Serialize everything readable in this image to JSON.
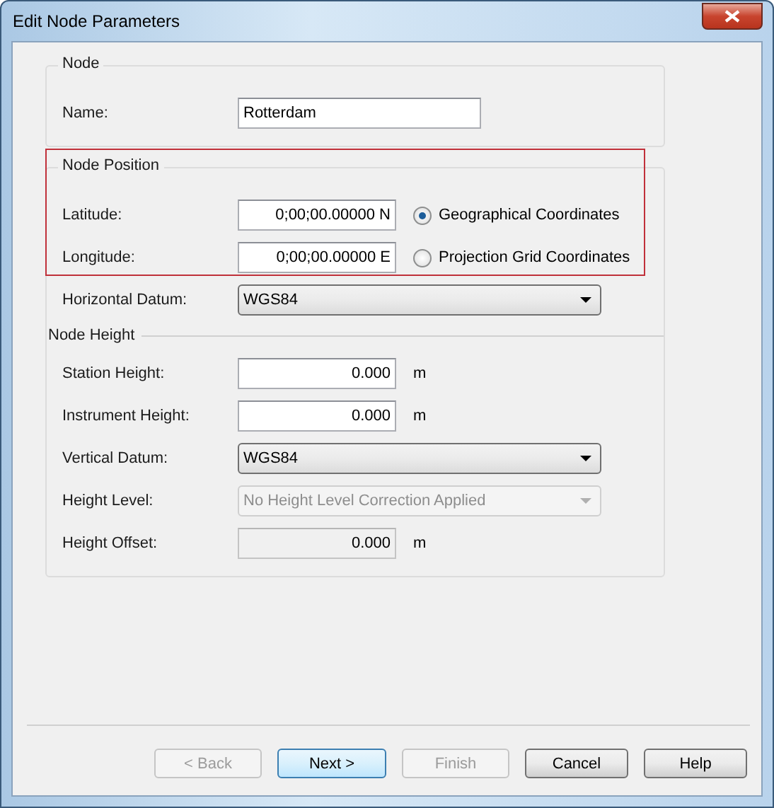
{
  "window": {
    "title": "Edit Node Parameters"
  },
  "node_group": {
    "title": "Node",
    "name_label": "Name:",
    "name_value": "Rotterdam"
  },
  "position_group": {
    "title": "Node Position",
    "highlighted": true,
    "rows": [
      {
        "label": "Latitude:",
        "value": "0;00;00.00000 N",
        "option": {
          "label": "Geographical Coordinates",
          "selected": true
        }
      },
      {
        "label": "Longitude:",
        "value": "0;00;00.00000 E",
        "option": {
          "label": "Projection Grid Coordinates",
          "selected": false
        }
      }
    ],
    "horizontal_datum": {
      "label": "Horizontal Datum:",
      "value": "WGS84"
    }
  },
  "height_group": {
    "title": "Node Height",
    "fields": [
      {
        "kind": "input",
        "label": "Station Height:",
        "value": "0.000",
        "unit": "m",
        "disabled": false
      },
      {
        "kind": "input",
        "label": "Instrument Height:",
        "value": "0.000",
        "unit": "m",
        "disabled": false
      },
      {
        "kind": "dropdown",
        "label": "Vertical Datum:",
        "value": "WGS84",
        "disabled": false
      },
      {
        "kind": "dropdown",
        "label": "Height Level:",
        "value": "No Height Level Correction Applied",
        "disabled": true
      },
      {
        "kind": "input",
        "label": "Height Offset:",
        "value": "0.000",
        "unit": "m",
        "disabled": true
      }
    ]
  },
  "buttons": [
    {
      "label": "< Back",
      "disabled": true,
      "default": false
    },
    {
      "label": "Next >",
      "disabled": false,
      "default": true
    },
    {
      "label": "Finish",
      "disabled": true,
      "default": false
    },
    {
      "label": "Cancel",
      "disabled": false,
      "default": false
    },
    {
      "label": "Help",
      "disabled": false,
      "default": false
    }
  ]
}
